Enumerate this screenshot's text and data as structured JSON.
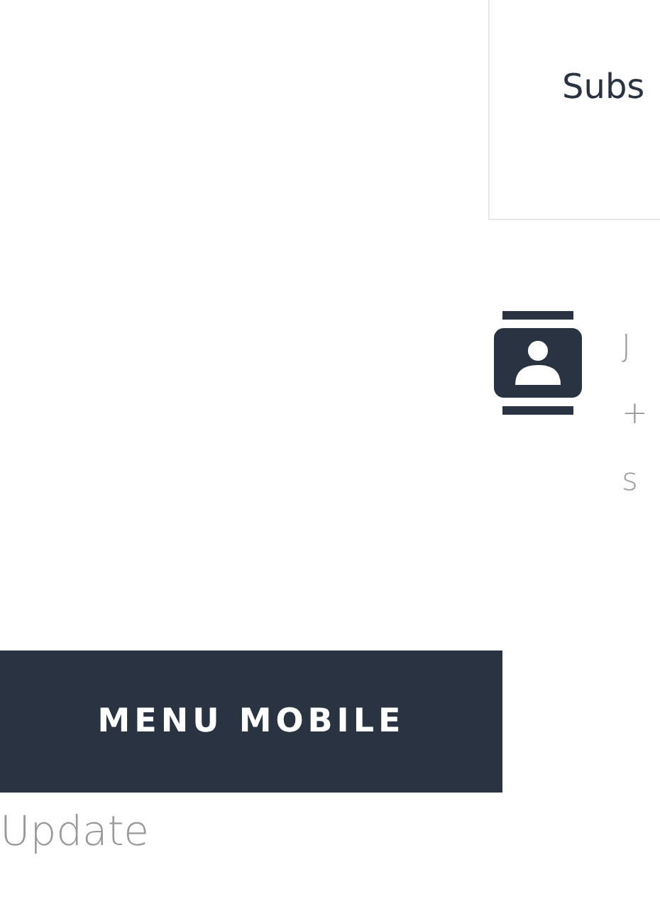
{
  "subscribe_card": {
    "label": "Subs"
  },
  "contact": {
    "lines": [
      "J",
      "+",
      "s"
    ]
  },
  "menu_button": {
    "label": "MENU MOBILE"
  },
  "footer_text": "Update"
}
